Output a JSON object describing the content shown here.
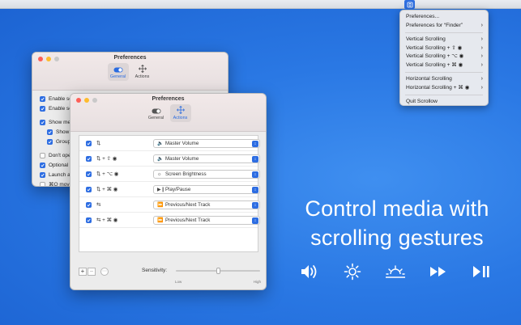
{
  "menu": {
    "items": [
      {
        "label": "Preferences...",
        "submenu": false
      },
      {
        "label": "Preferences for “Finder”",
        "submenu": true
      },
      {
        "sep": true
      },
      {
        "label": "Vertical Scrolling",
        "submenu": true
      },
      {
        "label": "Vertical Scrolling + ⇧ ◉",
        "submenu": true
      },
      {
        "label": "Vertical Scrolling + ⌥ ◉",
        "submenu": true
      },
      {
        "label": "Vertical Scrolling + ⌘ ◉",
        "submenu": true
      },
      {
        "sep": true
      },
      {
        "label": "Horizontal Scrolling",
        "submenu": true
      },
      {
        "label": "Horizontal Scrolling + ⌘ ◉",
        "submenu": true
      },
      {
        "sep": true
      },
      {
        "label": "Quit Scrollow",
        "submenu": false
      }
    ]
  },
  "back_window": {
    "title": "Preferences",
    "tabs": [
      {
        "label": "General",
        "active": true
      },
      {
        "label": "Actions",
        "active": false
      }
    ],
    "rows": [
      {
        "label": "Enable sc",
        "checked": true,
        "indent": 0
      },
      {
        "label": "Enable scr",
        "checked": true,
        "indent": 0
      },
      {
        "label": "",
        "checked": null,
        "indent": 0
      },
      {
        "label": "Show me",
        "checked": true,
        "indent": 0
      },
      {
        "label": "Show",
        "checked": true,
        "indent": 1
      },
      {
        "label": "Group",
        "checked": true,
        "indent": 1
      },
      {
        "label": "",
        "checked": null,
        "indent": 0
      },
      {
        "label": "Don't ope",
        "checked": false,
        "indent": 0
      },
      {
        "label": "Optional c",
        "checked": true,
        "indent": 0
      },
      {
        "label": "Launch a",
        "checked": true,
        "indent": 0
      },
      {
        "label": "⌘Q move",
        "checked": false,
        "indent": 0
      }
    ]
  },
  "front_window": {
    "title": "Preferences",
    "tabs": [
      {
        "label": "General",
        "active": false
      },
      {
        "label": "Actions",
        "active": true
      }
    ],
    "rows": [
      {
        "gesture": "⇅",
        "action": "Master Volume",
        "icon": "🔈"
      },
      {
        "gesture": "⇅ + ⇧ ◉",
        "action": "Master Volume",
        "icon": "🔈"
      },
      {
        "gesture": "⇅ + ⌥ ◉",
        "action": "Screen Brightness",
        "icon": "☼"
      },
      {
        "gesture": "⇅ + ⌘ ◉",
        "action": "Play/Pause",
        "icon": "▶❙"
      },
      {
        "gesture": "⇆",
        "action": "Previous/Next Track",
        "icon": "⏩"
      },
      {
        "gesture": "⇆ + ⌘ ◉",
        "action": "Previous/Next Track",
        "icon": "⏩"
      }
    ],
    "add_label": "+",
    "remove_label": "−",
    "sensitivity_label": "Sensitivity:",
    "sensitivity_value": 0.5,
    "low_label": "Low",
    "high_label": "High"
  },
  "headline": {
    "line1": "Control media with",
    "line2": "scrolling gestures"
  },
  "media_icons": [
    "volume-icon",
    "brightness-icon",
    "display-brightness-icon",
    "fast-forward-icon",
    "play-pause-icon"
  ],
  "colors": {
    "accent": "#2d6de2",
    "background": "#2a78e4"
  }
}
